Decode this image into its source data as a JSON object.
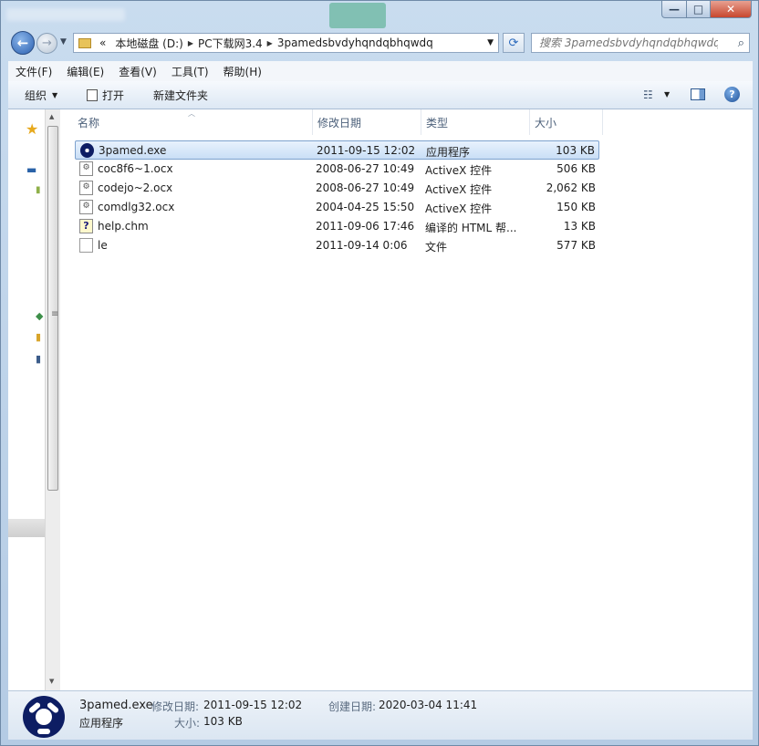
{
  "window": {
    "address_segments": [
      "«",
      "本地磁盘 (D:)",
      "PC下载网3.4",
      "3pamedsbvdyhqndqbhqwdq"
    ],
    "search_placeholder": "搜索 3pamedsbvdyhqndqbhqwdq",
    "controls": {
      "min": "—",
      "max": "□",
      "close": "✕"
    }
  },
  "menu": [
    "文件(F)",
    "编辑(E)",
    "查看(V)",
    "工具(T)",
    "帮助(H)"
  ],
  "toolbar": {
    "organize": "组织",
    "open": "打开",
    "new_folder": "新建文件夹"
  },
  "columns": {
    "name": "名称",
    "modified": "修改日期",
    "type": "类型",
    "size": "大小"
  },
  "files": [
    {
      "name": "3pamed.exe",
      "modified": "2011-09-15 12:02",
      "type": "应用程序",
      "size": "103 KB",
      "icon": "exe-icon",
      "selected": true
    },
    {
      "name": "coc8f6~1.ocx",
      "modified": "2008-06-27 10:49",
      "type": "ActiveX 控件",
      "size": "506 KB",
      "icon": "ocx-icon",
      "selected": false
    },
    {
      "name": "codejo~2.ocx",
      "modified": "2008-06-27 10:49",
      "type": "ActiveX 控件",
      "size": "2,062 KB",
      "icon": "ocx-icon",
      "selected": false
    },
    {
      "name": "comdlg32.ocx",
      "modified": "2004-04-25 15:50",
      "type": "ActiveX 控件",
      "size": "150 KB",
      "icon": "ocx-icon",
      "selected": false
    },
    {
      "name": "help.chm",
      "modified": "2011-09-06 17:46",
      "type": "编译的 HTML 帮...",
      "size": "13 KB",
      "icon": "chm-icon",
      "selected": false
    },
    {
      "name": "le",
      "modified": "2011-09-14 0:06",
      "type": "文件",
      "size": "577 KB",
      "icon": "file-icon",
      "selected": false
    }
  ],
  "details": {
    "name": "3pamed.exe",
    "type": "应用程序",
    "modified_label": "修改日期:",
    "modified": "2011-09-15 12:02",
    "created_label": "创建日期:",
    "created": "2020-03-04 11:41",
    "size_label": "大小:",
    "size": "103 KB"
  },
  "colors": {
    "selection": "#cce1f7",
    "selection_border": "#7da2ce",
    "exe_icon": "#0d1d63"
  }
}
